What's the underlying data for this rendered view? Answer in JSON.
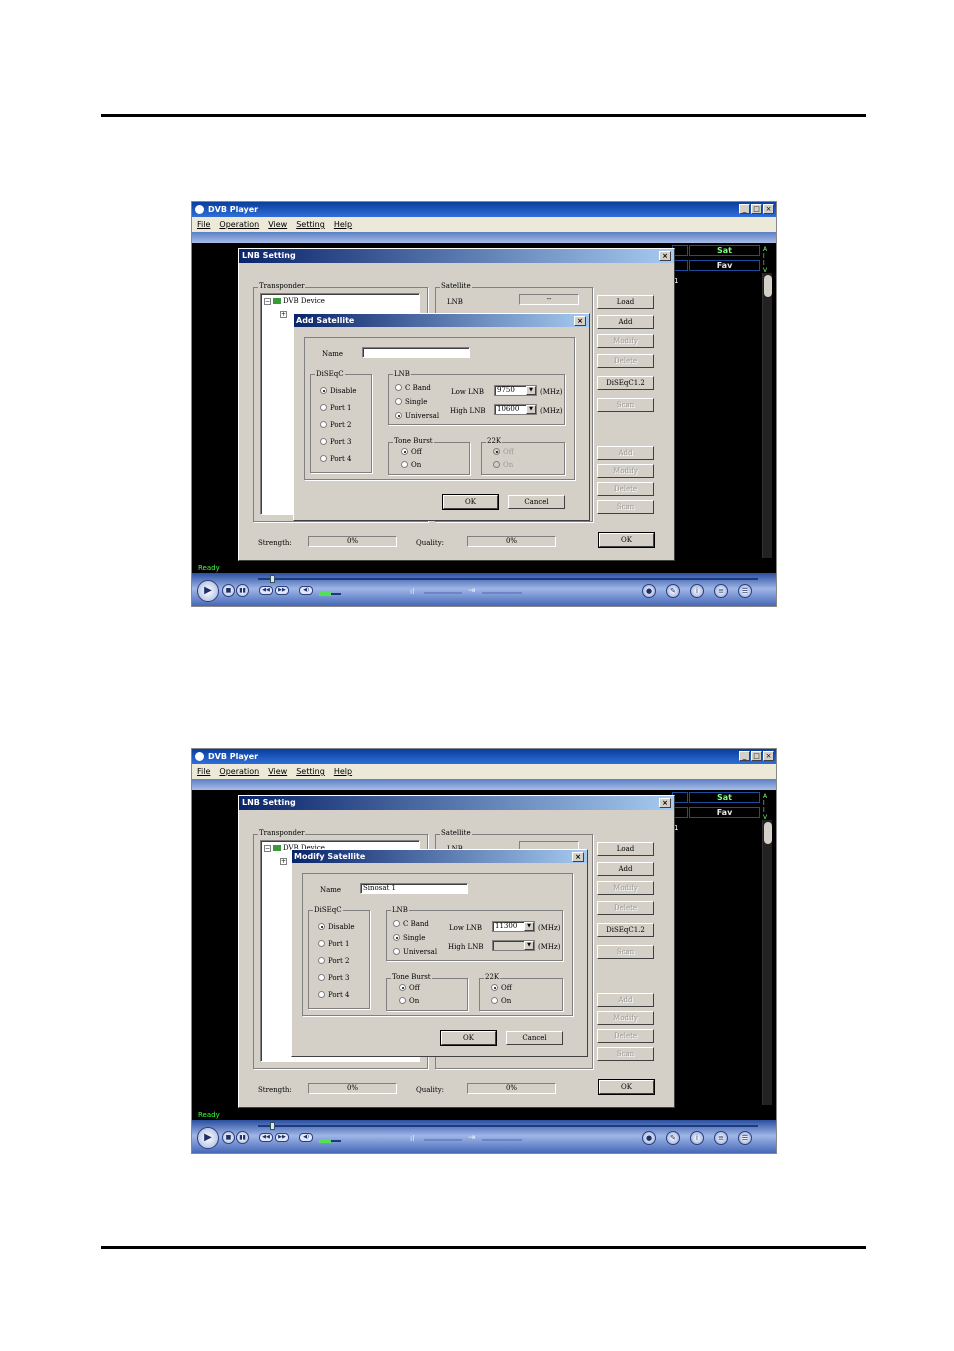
{
  "screenshots": [
    {
      "app_title": "DVB Player",
      "menu": [
        "File",
        "Operation",
        "View",
        "Setting",
        "Help"
      ],
      "window_buttons": [
        "_",
        "□",
        "×"
      ],
      "channel_buttons": {
        "sat": "Sat",
        "fav": "Fav"
      },
      "side_letters": [
        "A",
        "l",
        "l",
        "V",
        "R"
      ],
      "channel_number": "1",
      "status": "Ready",
      "lnb_dialog": {
        "title": "LNB Setting",
        "transponder_label": "Transponder",
        "tree_root": "DVB Device",
        "satellite_label": "Satellite",
        "lnb_label": "LNB",
        "lnb_value": "--",
        "buttons_top": [
          "Load",
          "Add",
          "Modify",
          "Delete",
          "DiSEqC1.2",
          "Scan"
        ],
        "buttons_bottom": [
          "Add",
          "Modify",
          "Delete",
          "Scan"
        ],
        "strength_label": "Strength:",
        "strength_value": "0%",
        "quality_label": "Quality:",
        "quality_value": "0%",
        "ok": "OK"
      },
      "sub_dialog": {
        "title": "Add Satellite",
        "name_label": "Name",
        "name_value": "",
        "diseqc_label": "DiSEqC",
        "diseqc_options": [
          "Disable",
          "Port 1",
          "Port 2",
          "Port 3",
          "Port 4"
        ],
        "diseqc_selected": 0,
        "lnb_group": "LNB",
        "lnb_options": [
          "C Band",
          "Single",
          "Universal"
        ],
        "lnb_selected": 2,
        "low_lnb_label": "Low LNB",
        "low_lnb_value": "9750",
        "high_lnb_label": "High LNB",
        "high_lnb_value": "10600",
        "unit": "(MHz)",
        "tone_burst_label": "Tone Burst",
        "tone_options": [
          "Off",
          "On"
        ],
        "tone_selected": 0,
        "k22_label": "22K",
        "k22_options": [
          "Off",
          "On"
        ],
        "k22_selected": 0,
        "ok": "OK",
        "cancel": "Cancel"
      }
    },
    {
      "app_title": "DVB Player",
      "menu": [
        "File",
        "Operation",
        "View",
        "Setting",
        "Help"
      ],
      "window_buttons": [
        "_",
        "□",
        "×"
      ],
      "channel_buttons": {
        "sat": "Sat",
        "fav": "Fav"
      },
      "side_letters": [
        "A",
        "l",
        "l",
        "V",
        "R"
      ],
      "channel_number": "1",
      "status": "Ready",
      "lnb_dialog": {
        "title": "LNB Setting",
        "transponder_label": "Transponder",
        "tree_root": "DVB Device",
        "satellite_label": "Satellite",
        "lnb_label": "LNB",
        "lnb_value": "",
        "buttons_top": [
          "Load",
          "Add",
          "Modify",
          "Delete",
          "DiSEqC1.2",
          "Scan"
        ],
        "buttons_bottom": [
          "Add",
          "Modify",
          "Delete",
          "Scan"
        ],
        "strength_label": "Strength:",
        "strength_value": "0%",
        "quality_label": "Quality:",
        "quality_value": "0%",
        "ok": "OK"
      },
      "sub_dialog": {
        "title": "Modify Satellite",
        "name_label": "Name",
        "name_value": "Sinosat 1",
        "diseqc_label": "DiSEqC",
        "diseqc_options": [
          "Disable",
          "Port 1",
          "Port 2",
          "Port 3",
          "Port 4"
        ],
        "diseqc_selected": 0,
        "lnb_group": "LNB",
        "lnb_options": [
          "C Band",
          "Single",
          "Universal"
        ],
        "lnb_selected": 1,
        "low_lnb_label": "Low LNB",
        "low_lnb_value": "11300",
        "high_lnb_label": "High LNB",
        "high_lnb_value": "",
        "unit": "(MHz)",
        "tone_burst_label": "Tone Burst",
        "tone_options": [
          "Off",
          "On"
        ],
        "tone_selected": 0,
        "k22_label": "22K",
        "k22_options": [
          "Off",
          "On"
        ],
        "k22_selected": 0,
        "ok": "OK",
        "cancel": "Cancel"
      }
    }
  ]
}
